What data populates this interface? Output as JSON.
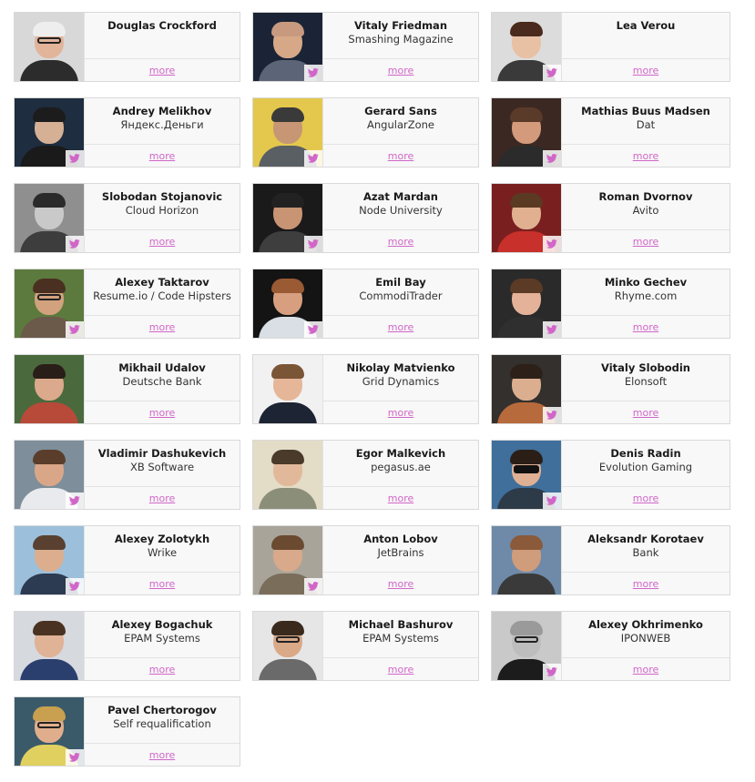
{
  "more_label": "more",
  "accent_color": "#d166c8",
  "twitter_icon": "twitter-bird-icon",
  "speakers": [
    {
      "name": "Douglas Crockford",
      "company": "",
      "twitter": false,
      "photo": {
        "bg": "#d8d8d8",
        "skin": "#e2b49a",
        "hair": "#eeeeee",
        "body": "#2c2c2c",
        "glasses": true
      }
    },
    {
      "name": "Vitaly Friedman",
      "company": "Smashing Magazine",
      "twitter": true,
      "photo": {
        "bg": "#1b2436",
        "skin": "#d7a887",
        "hair": "#c79a80",
        "body": "#5c6577"
      }
    },
    {
      "name": "Lea Verou",
      "company": "",
      "twitter": true,
      "photo": {
        "bg": "#dcdcdc",
        "skin": "#e8c0a4",
        "hair": "#4a2a1c",
        "body": "#3a3a3a"
      }
    },
    {
      "name": "Andrey Melikhov",
      "company": "Яндекс.Деньги",
      "twitter": true,
      "photo": {
        "bg": "#1e2d3f",
        "skin": "#d6b095",
        "hair": "#1c1c1c",
        "body": "#1a1a1a"
      }
    },
    {
      "name": "Gerard Sans",
      "company": "AngularZone",
      "twitter": true,
      "photo": {
        "bg": "#e4c84d",
        "skin": "#c79675",
        "hair": "#3a3a3a",
        "body": "#595f63"
      }
    },
    {
      "name": "Mathias Buus Madsen",
      "company": "Dat",
      "twitter": true,
      "photo": {
        "bg": "#3c2822",
        "skin": "#d39a7c",
        "hair": "#5a3a28",
        "body": "#2b2b2b"
      }
    },
    {
      "name": "Slobodan Stojanovic",
      "company": "Cloud Horizon",
      "twitter": true,
      "photo": {
        "bg": "#8f8f8f",
        "skin": "#c9c9c9",
        "hair": "#2a2a2a",
        "body": "#3d3d3d"
      }
    },
    {
      "name": "Azat Mardan",
      "company": "Node University",
      "twitter": true,
      "photo": {
        "bg": "#1a1a1a",
        "skin": "#c89474",
        "hair": "#222222",
        "body": "#3e3e3e"
      }
    },
    {
      "name": "Roman Dvornov",
      "company": "Avito",
      "twitter": true,
      "photo": {
        "bg": "#7a1f1f",
        "skin": "#e0b091",
        "hair": "#5a3a22",
        "body": "#c8302b"
      }
    },
    {
      "name": "Alexey Taktarov",
      "company": "Resume.io / Code Hipsters",
      "twitter": true,
      "photo": {
        "bg": "#5d7a3e",
        "skin": "#d2a27e",
        "hair": "#4a3020",
        "body": "#6b5a4a",
        "glasses": true
      }
    },
    {
      "name": "Emil Bay",
      "company": "CommodiTrader",
      "twitter": true,
      "photo": {
        "bg": "#141414",
        "skin": "#d79f7f",
        "hair": "#9a5a34",
        "body": "#d9dfe4"
      }
    },
    {
      "name": "Minko Gechev",
      "company": "Rhyme.com",
      "twitter": true,
      "photo": {
        "bg": "#2a2a2a",
        "skin": "#e4b299",
        "hair": "#5b3b26",
        "body": "#2f2f2f"
      }
    },
    {
      "name": "Mikhail Udalov",
      "company": "Deutsche Bank",
      "twitter": false,
      "photo": {
        "bg": "#4a6a3e",
        "skin": "#dba98b",
        "hair": "#2a1e18",
        "body": "#b84a3a"
      }
    },
    {
      "name": "Nikolay Matvienko",
      "company": "Grid Dynamics",
      "twitter": false,
      "photo": {
        "bg": "#f1f1f1",
        "skin": "#e6b699",
        "hair": "#7a5536",
        "body": "#1d2433"
      }
    },
    {
      "name": "Vitaly Slobodin",
      "company": "Elonsoft",
      "twitter": true,
      "photo": {
        "bg": "#33302e",
        "skin": "#dcae90",
        "hair": "#2c2018",
        "body": "#b76a3c"
      }
    },
    {
      "name": "Vladimir Dashukevich",
      "company": "XB Software",
      "twitter": true,
      "photo": {
        "bg": "#7e8e9a",
        "skin": "#d9a788",
        "hair": "#5a3d2a",
        "body": "#e8eaee"
      }
    },
    {
      "name": "Egor Malkevich",
      "company": "pegasus.ae",
      "twitter": false,
      "photo": {
        "bg": "#e3dcc6",
        "skin": "#e2b89b",
        "hair": "#4a3a2a",
        "body": "#8b8f7a"
      }
    },
    {
      "name": "Denis Radin",
      "company": "Evolution Gaming",
      "twitter": true,
      "photo": {
        "bg": "#3f6f9a",
        "skin": "#dfb094",
        "hair": "#2a1e16",
        "body": "#2d3a48",
        "shades": true
      }
    },
    {
      "name": "Alexey Zolotykh",
      "company": "Wrike",
      "twitter": true,
      "photo": {
        "bg": "#9cc0db",
        "skin": "#dcae8e",
        "hair": "#5a4030",
        "body": "#2c3a52"
      }
    },
    {
      "name": "Anton Lobov",
      "company": "JetBrains",
      "twitter": true,
      "photo": {
        "bg": "#a9a49a",
        "skin": "#d8a98a",
        "hair": "#6a4a30",
        "body": "#7a6d5a"
      }
    },
    {
      "name": "Aleksandr Korotaev",
      "company": "Bank",
      "twitter": false,
      "photo": {
        "bg": "#6e8aa8",
        "skin": "#cf9c7c",
        "hair": "#8a5a3a",
        "body": "#3a3a3a"
      }
    },
    {
      "name": "Alexey Bogachuk",
      "company": "EPAM Systems",
      "twitter": false,
      "photo": {
        "bg": "#d6d9de",
        "skin": "#e0b296",
        "hair": "#4a3222",
        "body": "#2a3f6e"
      }
    },
    {
      "name": "Michael Bashurov",
      "company": "EPAM Systems",
      "twitter": false,
      "photo": {
        "bg": "#e6e6e6",
        "skin": "#d9a988",
        "hair": "#3a2a1e",
        "body": "#6a6a6a",
        "glasses": true
      }
    },
    {
      "name": "Alexey Okhrimenko",
      "company": "IPONWEB",
      "twitter": true,
      "photo": {
        "bg": "#c9c9c9",
        "skin": "#bdbdbd",
        "hair": "#9a9a9a",
        "body": "#1c1c1c",
        "glasses": true
      }
    },
    {
      "name": "Pavel Chertorogov",
      "company": "Self requalification",
      "twitter": true,
      "photo": {
        "bg": "#3a5a6a",
        "skin": "#e0ae8c",
        "hair": "#c8a050",
        "body": "#e0d060",
        "glasses": true
      }
    }
  ]
}
